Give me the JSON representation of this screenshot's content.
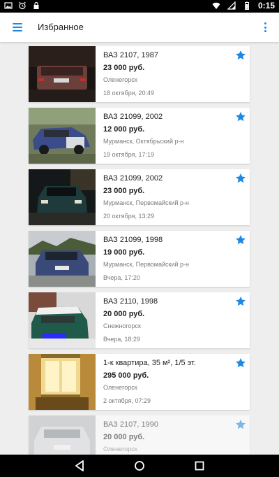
{
  "status_bar": {
    "time": "0:15"
  },
  "app_bar": {
    "title": "Избранное"
  },
  "listings": [
    {
      "title": "ВАЗ 2107, 1987",
      "price": "23 000 руб.",
      "location": "Оленегорск",
      "date": "18 октября, 20:49"
    },
    {
      "title": "ВАЗ 21099, 2002",
      "price": "12 000 руб.",
      "location": "Мурманск, Октябрьский р-н",
      "date": "19 октября, 17:19"
    },
    {
      "title": "ВАЗ 21099, 2002",
      "price": "23 000 руб.",
      "location": "Мурманск, Первомайский р-н",
      "date": "20 октября, 13:29"
    },
    {
      "title": "ВАЗ 21099, 1998",
      "price": "19 000 руб.",
      "location": "Мурманск, Первомайский р-н",
      "date": "Вчера, 17:20"
    },
    {
      "title": "ВАЗ 2110, 1998",
      "price": "20 000 руб.",
      "location": "Снежногорск",
      "date": "Вчера, 18:29"
    },
    {
      "title": "1-к квартира, 35 м², 1/5 эт.",
      "price": "295 000 руб.",
      "location": "Оленегорск",
      "date": "2 октября, 07:29"
    },
    {
      "title": "ВАЗ 2107, 1990",
      "price": "20 000 руб.",
      "location": "Оленегорск",
      "date": ""
    }
  ],
  "colors": {
    "accent": "#1e88e5",
    "background": "#eeeeee"
  },
  "icons": {
    "menu": "hamburger-menu-icon",
    "overflow": "more-vert-icon",
    "favorite": "star-icon",
    "nav_back": "back-triangle-icon",
    "nav_home": "home-circle-icon",
    "nav_recents": "recents-square-icon"
  }
}
